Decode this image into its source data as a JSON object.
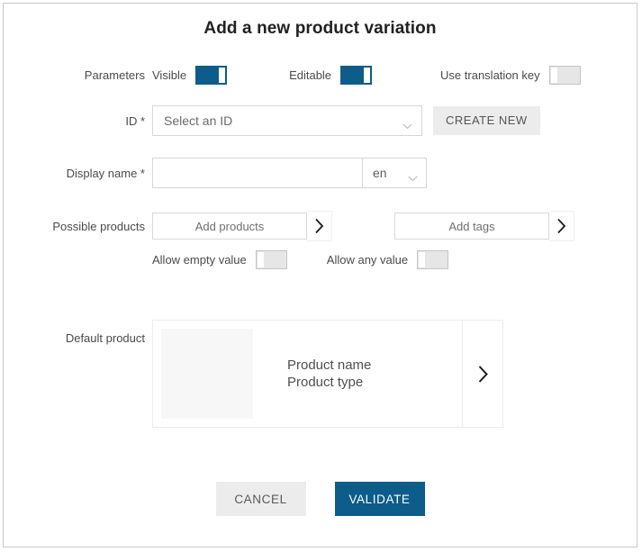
{
  "dialog": {
    "title": "Add a new product variation"
  },
  "parameters": {
    "label": "Parameters",
    "toggles": [
      {
        "label": "Visible",
        "state": "on"
      },
      {
        "label": "Editable",
        "state": "on"
      },
      {
        "label": "Use translation key",
        "state": "off"
      }
    ]
  },
  "id_field": {
    "label": "ID *",
    "selected": "Select an ID",
    "create_button": "CREATE NEW"
  },
  "display_name": {
    "label": "Display name *",
    "value": "",
    "placeholder": "",
    "language": "en"
  },
  "possible_products": {
    "label": "Possible products",
    "add_products_button": "Add products",
    "add_tags_button": "Add tags",
    "allow_empty_label": "Allow empty value",
    "allow_empty_state": "off",
    "allow_any_label": "Allow any value",
    "allow_any_state": "off"
  },
  "default_product": {
    "label": "Default product",
    "name": "Product name",
    "type": "Product type"
  },
  "footer": {
    "cancel_label": "CANCEL",
    "validate_label": "VALIDATE"
  },
  "colors": {
    "accent": "#0d5c8a",
    "button_grey": "#ececec",
    "border": "#d6d6d6",
    "text": "#4a4a4a"
  },
  "icons": {
    "chevron_down": "chevron-down-icon",
    "chevron_right": "chevron-right-icon"
  }
}
